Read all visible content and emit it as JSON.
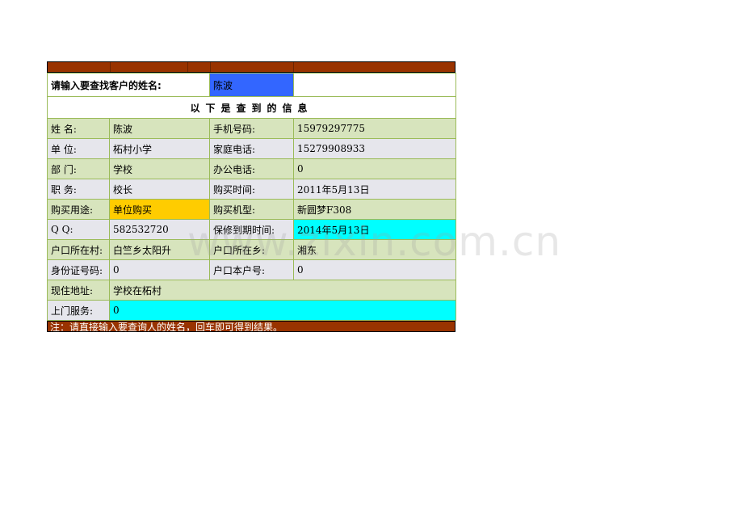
{
  "search": {
    "label": "请输入要查找客户的姓名:",
    "value": "陈波"
  },
  "header": {
    "title": "以下是查到的信息"
  },
  "fields": {
    "name": {
      "label": "姓    名:",
      "value": "陈波"
    },
    "mobile": {
      "label": "手机号码:",
      "value": "15979297775"
    },
    "unit": {
      "label": "单    位:",
      "value": "柘村小学"
    },
    "home_tel": {
      "label": "家庭电话:",
      "value": "15279908933"
    },
    "dept": {
      "label": "部    门:",
      "value": "学校"
    },
    "office_tel": {
      "label": "办公电话:",
      "value": "0"
    },
    "position": {
      "label": "职    务:",
      "value": "校长"
    },
    "buy_time": {
      "label": "购买时间:",
      "value": "2011年5月13日"
    },
    "purpose": {
      "label": "购买用途:",
      "value": "单位购买"
    },
    "model": {
      "label": "购买机型:",
      "value": "新圆梦F308"
    },
    "qq": {
      "label": "Q       Q:",
      "value": "582532720"
    },
    "warranty": {
      "label": "保修到期时间:",
      "value": "2014年5月13日"
    },
    "village": {
      "label": "户口所在村:",
      "value": "白竺乡太阳升"
    },
    "township": {
      "label": "户口所在乡:",
      "value": "湘东"
    },
    "id_no": {
      "label": "身份证号码:",
      "value": "0"
    },
    "household": {
      "label": "户口本户号:",
      "value": "0"
    },
    "address": {
      "label": "现住地址:",
      "value": "学校在柘村"
    },
    "service": {
      "label": "上门服务:",
      "value": "0"
    }
  },
  "note": "注：请直接输入要查询人的姓名，回车即可得到结果。",
  "watermark": "www.zixin.com.cn",
  "colors": {
    "bar": "#993300",
    "row_green": "#d7e4bd",
    "row_grey": "#e6e6ec",
    "highlight_blue": "#3366ff",
    "highlight_yellow": "#ffcc00",
    "highlight_cyan": "#00ffff"
  }
}
